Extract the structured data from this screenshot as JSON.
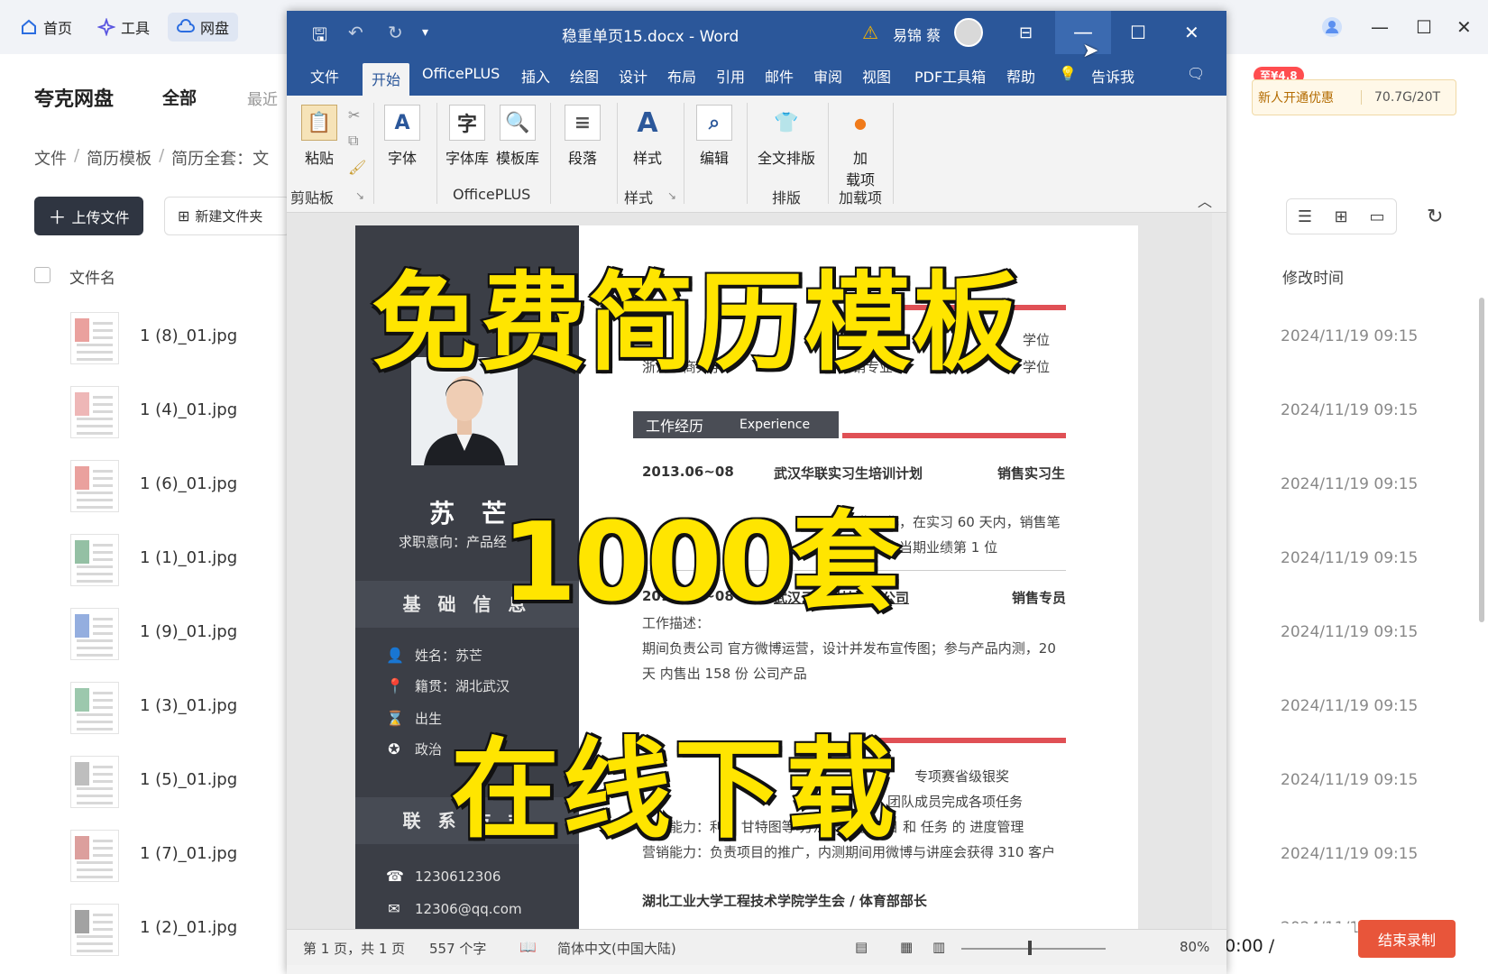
{
  "cloud": {
    "nav": [
      {
        "label": "首页",
        "icon": "home-icon"
      },
      {
        "label": "工具",
        "icon": "sparkle-icon"
      },
      {
        "label": "网盘",
        "icon": "cloud-icon"
      }
    ],
    "brand": "夸克网盘",
    "tab_all": "全部",
    "tab_recent": "最近",
    "breadcrumb": [
      "文件",
      "简历模板",
      "简历全套：文"
    ],
    "upload_label": "上传文件",
    "newfolder_label": "新建文件夹",
    "col_name": "文件名",
    "col_mtime": "修改时间",
    "promo_badge": "至¥4.8",
    "promo_text": "新人开通优惠",
    "storage": "70.7G/20T",
    "files": [
      {
        "name": "1 (8)_01.jpg",
        "time": "2024/11/19 09:15"
      },
      {
        "name": "1 (4)_01.jpg",
        "time": "2024/11/19 09:15"
      },
      {
        "name": "1 (6)_01.jpg",
        "time": "2024/11/19 09:15"
      },
      {
        "name": "1 (1)_01.jpg",
        "time": "2024/11/19 09:15"
      },
      {
        "name": "1 (9)_01.jpg",
        "time": "2024/11/19 09:15"
      },
      {
        "name": "1 (3)_01.jpg",
        "time": "2024/11/19 09:15"
      },
      {
        "name": "1 (5)_01.jpg",
        "time": "2024/11/19 09:15"
      },
      {
        "name": "1 (7)_01.jpg",
        "time": "2024/11/19 09:15"
      },
      {
        "name": "1 (2)_01.jpg",
        "time": "2024/11/19 09:15"
      }
    ],
    "timer": "00:00 /",
    "timer_button": "结束录制"
  },
  "word": {
    "title": "稳重单页15.docx  -  Word",
    "user": "易锦 蔡",
    "menu": [
      "文件",
      "开始",
      "OfficePLUS",
      "插入",
      "绘图",
      "设计",
      "布局",
      "引用",
      "邮件",
      "审阅",
      "视图",
      "PDF工具箱",
      "帮助",
      "告诉我"
    ],
    "ribbon": {
      "paste": "粘贴",
      "font": "字体",
      "fontlib": "字体库",
      "templatelib": "模板库",
      "paragraph": "段落",
      "styles": "样式",
      "edit": "编辑",
      "fulltext": "全文排版",
      "addin1": "加",
      "addin2": "载项",
      "grp_clipboard": "剪贴板",
      "grp_officeplus": "OfficePLUS",
      "grp_styles": "样式",
      "grp_layout": "排版",
      "grp_addins": "加载项"
    },
    "resume": {
      "name": "苏 芒",
      "intent": "求职意向：产品经",
      "sec_basic": "基 础 信 息",
      "basic": [
        "姓名：苏芒",
        "籍贯：湖北武汉",
        "出生",
        "政治"
      ],
      "sec_contact": "联 系 方 式",
      "phone": "1230612306",
      "email": "12306@qq.com",
      "edu_degree1": "学位",
      "edu_school": "浙江工商大学",
      "edu_major": "营销专业",
      "edu_degree2": "学位",
      "sec_work": "工作经历",
      "sec_work_en": "Experience",
      "job1_date": "2013.06~08",
      "job1_org": "武汉华联实习生培训计划",
      "job1_role": "销售实习生",
      "job1_line1": "售工作，在实习 60 天内，销售笔",
      "job1_line2": "排店内当期业绩第 1 位",
      "job2_date": "2014.06~08",
      "job2_org": "武汉云创科技有限公司",
      "job2_role": "销售专员",
      "job2_desc_label": "工作描述：",
      "job2_line1": "期间负责公司 官方微博运营，设计并发布宣传图；参与产品内测，20",
      "job2_line2": "天 内售出 158 份 公司产品",
      "act_prize": "专项赛省级银奖",
      "act_line1": "团队成员完成各项任务",
      "act_line2": "管理能力：利用  甘特图等  方法来进行 项目 和 任务 的 进度管理",
      "act_line3": "营销能力：负责项目的推广，内测期间用微博与讲座会获得 310 客户",
      "act_line4": "湖北工业大学工程技术学院学生会 / 体育部部长"
    },
    "status": {
      "page": "第 1 页，共 1 页",
      "words": "557 个字",
      "lang": "简体中文(中国大陆)",
      "zoom": "80%"
    }
  },
  "overlay": {
    "line1": "免费简历模板",
    "line2": "1000套",
    "line3": "在线下载"
  }
}
